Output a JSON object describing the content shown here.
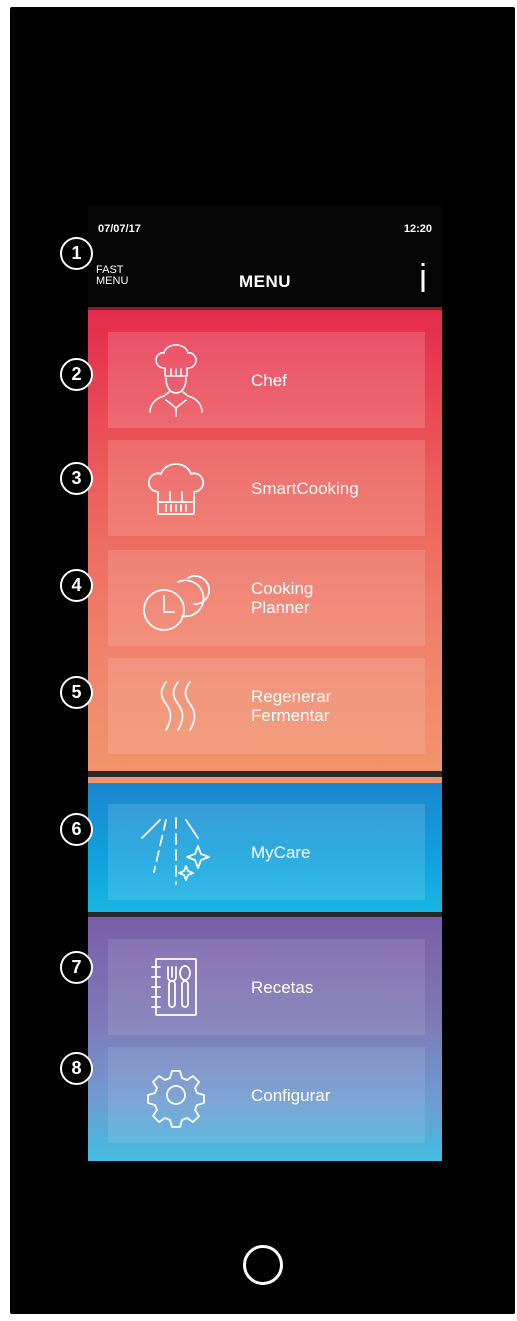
{
  "status": {
    "date": "07/07/17",
    "time": "12:20"
  },
  "header": {
    "fast_menu": "FAST\nMENU",
    "title": "MENU",
    "info_icon": "info-icon"
  },
  "tiles": [
    {
      "label": "Chef",
      "icon": "chef-icon"
    },
    {
      "label": "SmartCooking",
      "icon": "chef-hat-icon"
    },
    {
      "label": "Cooking\nPlanner",
      "icon": "clocks-icon"
    },
    {
      "label": "Regenerar\nFermentar",
      "icon": "steam-icon"
    },
    {
      "label": "MyCare",
      "icon": "cleaning-spray-icon"
    },
    {
      "label": "Recetas",
      "icon": "recipe-book-icon"
    },
    {
      "label": "Configurar",
      "icon": "gear-icon"
    }
  ],
  "callouts": [
    "1",
    "2",
    "3",
    "4",
    "5",
    "6",
    "7",
    "8"
  ],
  "colors": {
    "red_top": "#e52a4c",
    "orange_bottom": "#f3a26b",
    "blue": "#0fa3de",
    "purple": "#7a5ea9",
    "cyan": "#41bde0"
  }
}
